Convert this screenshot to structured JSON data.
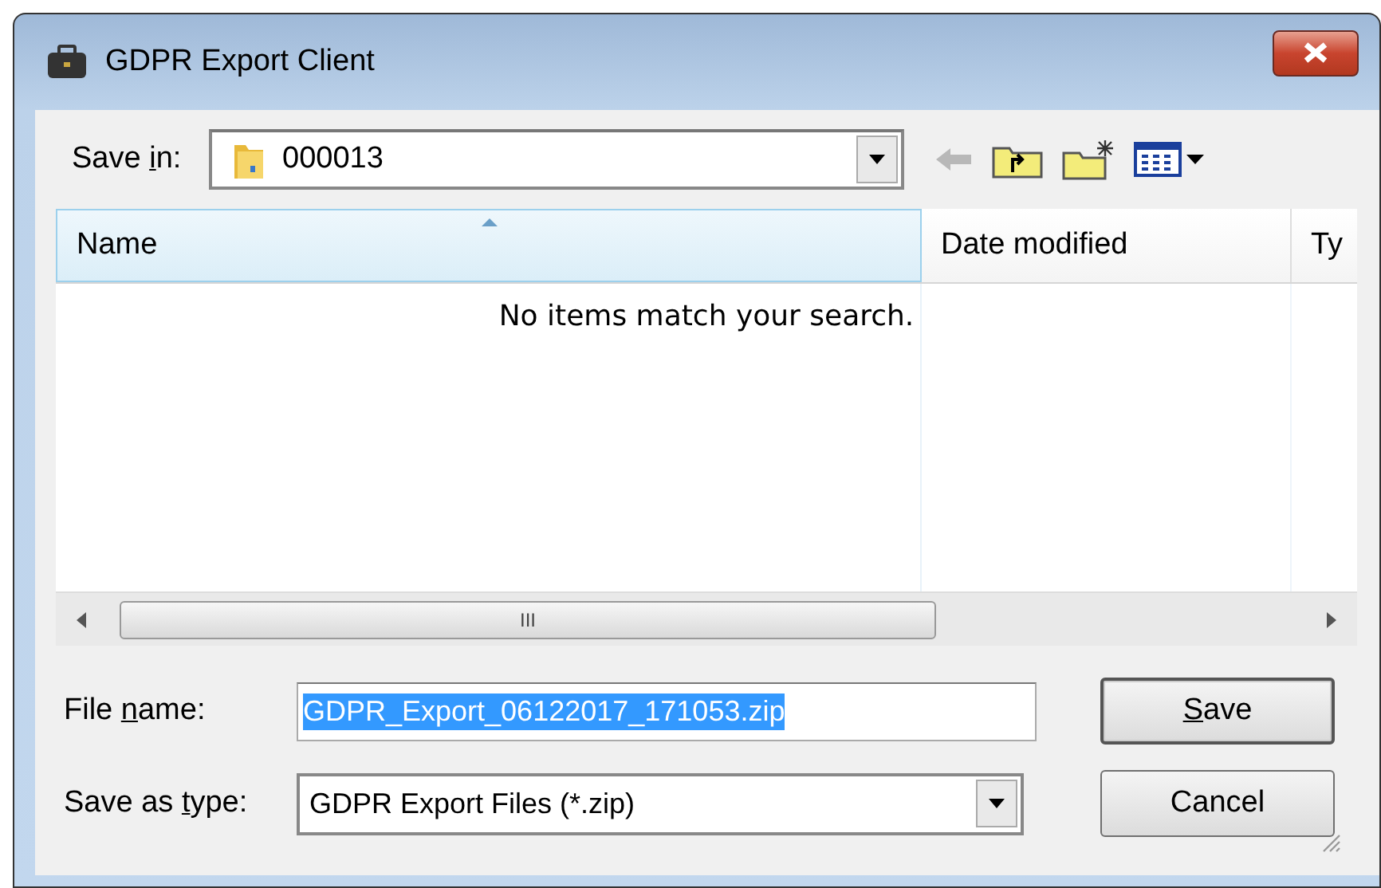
{
  "window": {
    "title": "GDPR Export Client"
  },
  "save_in": {
    "label": {
      "before": "Save ",
      "key": "i",
      "after": "n:"
    },
    "value": "000013"
  },
  "list": {
    "columns": [
      {
        "label": "Name",
        "sorted": true
      },
      {
        "label": "Date modified",
        "sorted": false
      },
      {
        "label": "Ty",
        "sorted": false
      }
    ],
    "empty_message": "No items match your search.",
    "scrollbar_thumb": "III"
  },
  "file_name": {
    "label": {
      "before": "File ",
      "key": "n",
      "after": "ame:"
    },
    "value": "GDPR_Export_06122017_171053.zip",
    "selected": true
  },
  "save_as_type": {
    "label": {
      "before": "Save as ",
      "key": "t",
      "after": "ype:"
    },
    "value": "GDPR Export Files (*.zip)"
  },
  "buttons": [
    {
      "label": {
        "key": "S",
        "after": "ave"
      },
      "default": true
    },
    {
      "label": {
        "before": "Cancel"
      },
      "default": false
    }
  ]
}
